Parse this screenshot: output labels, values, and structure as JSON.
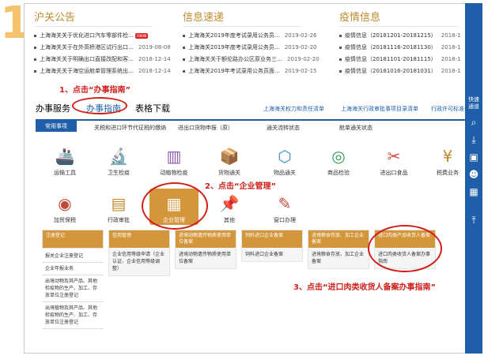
{
  "step": "1",
  "news": [
    {
      "title": "沪关公告",
      "items": [
        {
          "t": "上海海关关于优化进口汽车零部件检…",
          "d": "",
          "badge": "new"
        },
        {
          "t": "上海海关关于在外高桥港区试行出口…",
          "d": "2019-08-08"
        },
        {
          "t": "上海海关关于明确出口直接改配和客…",
          "d": "2018-12-14"
        },
        {
          "t": "上海海关关于海空运舱单管理系统出…",
          "d": "2018-12-14"
        }
      ]
    },
    {
      "title": "信息速递",
      "items": [
        {
          "t": "上海海关2019年度考试录用公务员…",
          "d": "2019-02-26"
        },
        {
          "t": "上海海关2019年度考试录用公务员…",
          "d": "2019-02-20"
        },
        {
          "t": "上海海关关于额伦路办公区原业务三…",
          "d": "2019-02-20"
        },
        {
          "t": "上海海关2019年考试录用公务员面…",
          "d": "2019-02-15"
        }
      ]
    },
    {
      "title": "疫情信息",
      "items": [
        {
          "t": "疫情信息（20181201-20181215）",
          "d": "2018-1"
        },
        {
          "t": "疫情信息（20181116-20181130）",
          "d": "2018-1"
        },
        {
          "t": "疫情信息（20181101-20181115）",
          "d": "2018-1"
        },
        {
          "t": "疫情信息（20181016-20181031）",
          "d": "2018-1"
        }
      ]
    }
  ],
  "annotations": {
    "a1": "1、点击“办事指南”",
    "a2": "2、点击“企业管理”",
    "a3": "3、点击“进口肉类收货人备案办事指南”"
  },
  "main_tabs": {
    "t1": "办事服务",
    "t2": "办事指南",
    "t3": "表格下载"
  },
  "top_links": [
    "上海海关权力和责任清单",
    "上海海关行政审批事项目录清单",
    "行政许可标准化"
  ],
  "subnav": [
    "常用事项",
    "关税和进口环节代征税的缴纳",
    "进出口货物申报（原）",
    "通关流转状态",
    "舱单通关状态"
  ],
  "icons": [
    {
      "label": "运输工具",
      "glyph": "🚢"
    },
    {
      "label": "卫生检疫",
      "glyph": "🔬"
    },
    {
      "label": "动植物检疫",
      "glyph": "▥"
    },
    {
      "label": "货物通关",
      "glyph": "📦"
    },
    {
      "label": "物品通关",
      "glyph": "⬡"
    },
    {
      "label": "商品检验",
      "glyph": "◎"
    },
    {
      "label": "进出口食品",
      "glyph": "✂"
    },
    {
      "label": "税费业务",
      "glyph": "¥"
    },
    {
      "label": "加贸保税",
      "glyph": "◉"
    },
    {
      "label": "行政审批",
      "glyph": "▤"
    },
    {
      "label": "企业管理",
      "glyph": "▦"
    },
    {
      "label": "其他",
      "glyph": "📌"
    },
    {
      "label": "窗口办理",
      "glyph": "✎"
    }
  ],
  "cards": [
    {
      "head": "注册登记",
      "body": ""
    },
    {
      "head": "信用管理",
      "body": "企业信用等级申请（企业认证、企业信用等级调整）"
    },
    {
      "head": "进境动物遗传物质使用单位备案",
      "body": "进境动物遗传物质使用单位备案"
    },
    {
      "head": "饲料进口企业备案",
      "body": "饲料进口企业备案"
    },
    {
      "head": "进境粮食存放、加工企业备案",
      "body": "进境粮食存放、加工企业备案"
    },
    {
      "head": "进口肉类产品收货人备案",
      "body": "进口肉类收货人备案办事指南"
    }
  ],
  "left_list": [
    "报关企业注册登记",
    "企业年报业务",
    "出境动物及其产品、其他检疫物的生产、加工、存放单位注册登记",
    "出境植物及其产品、其他检疫物的生产、加工、存放单位注册登记"
  ],
  "right_bar": {
    "label": "快速通道"
  }
}
